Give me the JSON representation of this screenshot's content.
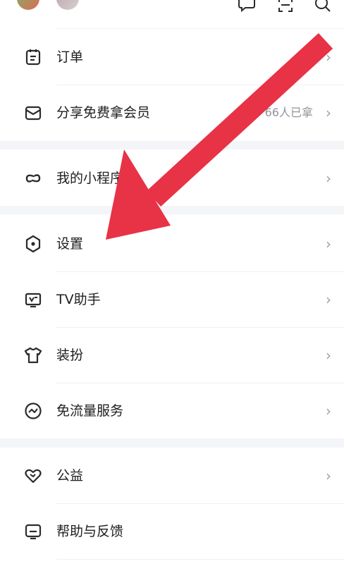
{
  "menu": {
    "group1": [
      {
        "label": "订单",
        "icon": "order-icon"
      },
      {
        "label": "分享免费拿会员",
        "icon": "gift-box-icon",
        "extra": "66人已拿"
      }
    ],
    "group2": [
      {
        "label": "我的小程序",
        "icon": "link-icon"
      }
    ],
    "group3": [
      {
        "label": "设置",
        "icon": "settings-hexagon-icon"
      },
      {
        "label": "TV助手",
        "icon": "tv-icon"
      },
      {
        "label": "装扮",
        "icon": "shirt-icon"
      },
      {
        "label": "免流量服务",
        "icon": "trend-circle-icon"
      }
    ],
    "group4": [
      {
        "label": "公益",
        "icon": "heart-icon"
      },
      {
        "label": "帮助与反馈",
        "icon": "feedback-icon"
      }
    ],
    "chevron": "›"
  },
  "colors": {
    "arrow": "#e83245",
    "icon_stroke": "#2b2b2b",
    "divider": "#f3f5f8"
  }
}
